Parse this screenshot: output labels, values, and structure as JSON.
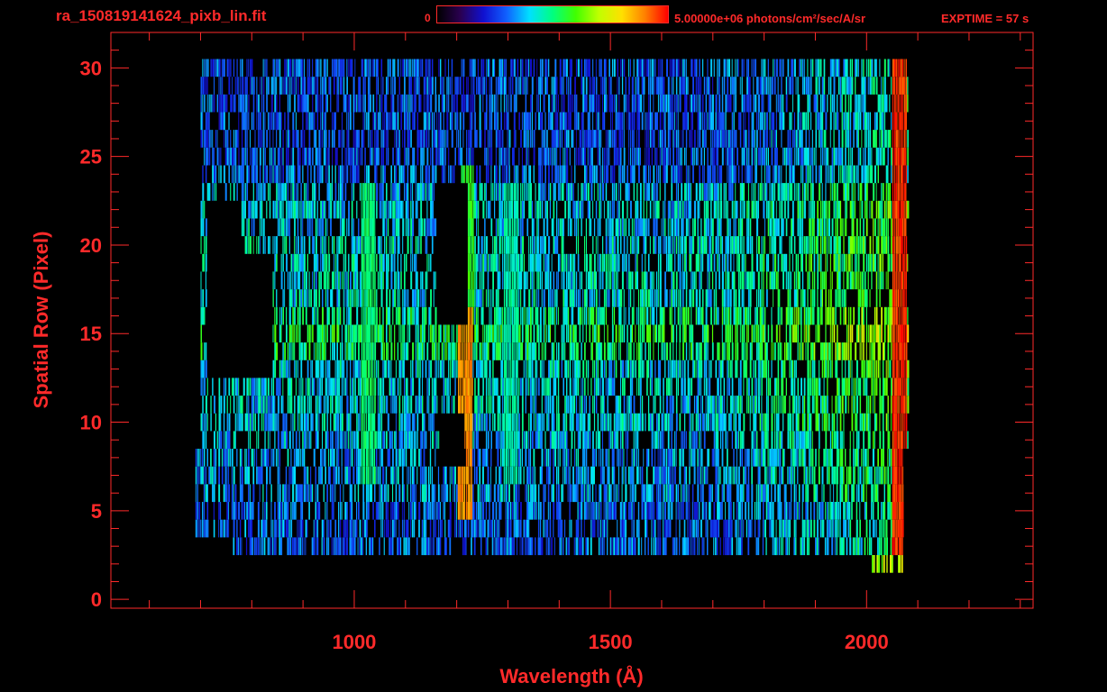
{
  "header": {
    "filename": "ra_150819141624_pixb_lin.fit",
    "colorbar_min_label": "0",
    "colorbar_max_label": "5.00000e+06 photons/cm²/sec/A/sr",
    "exptime_label": "EXPTIME = 57 s"
  },
  "colors": {
    "axis": "#ff2a2a",
    "background": "#000000",
    "colormap": [
      "#000000",
      "#2a0050",
      "#1010d0",
      "#1060ff",
      "#00e0ff",
      "#00ff80",
      "#40ff00",
      "#c0ff00",
      "#ffe000",
      "#ff8000",
      "#ff0000"
    ]
  },
  "chart_data": {
    "type": "heatmap",
    "title": "ra_150819141624_pixb_lin.fit",
    "xlabel": "Wavelength (Å)",
    "ylabel": "Spatial Row (Pixel)",
    "xlim": [
      525,
      2325
    ],
    "ylim": [
      -0.5,
      32
    ],
    "xticks": [
      1000,
      1500,
      2000
    ],
    "yticks": [
      0,
      5,
      10,
      15,
      20,
      25,
      30
    ],
    "colorbar": {
      "min": 0,
      "max": 5000000,
      "units": "photons/cm²/sec/A/sr"
    },
    "rows": [
      {
        "row": 2,
        "x_start": 2010,
        "x_end": 2070,
        "level": 0.5
      },
      {
        "row": 3,
        "x_start": 760,
        "x_end": 2070,
        "level": 0.3
      },
      {
        "row": 4,
        "x_start": 690,
        "x_end": 2070,
        "level": 0.3
      },
      {
        "row": 5,
        "x_start": 690,
        "x_end": 2070,
        "level": 0.3
      },
      {
        "row": 6,
        "x_start": 690,
        "x_end": 2070,
        "level": 0.35
      },
      {
        "row": 7,
        "x_start": 690,
        "x_end": 2070,
        "level": 0.35
      },
      {
        "row": 8,
        "x_start": 690,
        "x_end": 2070,
        "level": 0.35
      },
      {
        "row": 9,
        "x_start": 700,
        "x_end": 2080,
        "level": 0.38
      },
      {
        "row": 10,
        "x_start": 700,
        "x_end": 2080,
        "level": 0.4
      },
      {
        "row": 11,
        "x_start": 700,
        "x_end": 2080,
        "level": 0.4
      },
      {
        "row": 12,
        "x_start": 700,
        "x_end": 2080,
        "level": 0.4
      },
      {
        "row": 13,
        "x_start": 700,
        "x_end": 2080,
        "level": 0.42
      },
      {
        "row": 14,
        "x_start": 700,
        "x_end": 2080,
        "level": 0.5
      },
      {
        "row": 15,
        "x_start": 700,
        "x_end": 2080,
        "level": 0.52
      },
      {
        "row": 16,
        "x_start": 700,
        "x_end": 2080,
        "level": 0.48
      },
      {
        "row": 17,
        "x_start": 700,
        "x_end": 2080,
        "level": 0.42
      },
      {
        "row": 18,
        "x_start": 700,
        "x_end": 2080,
        "level": 0.42
      },
      {
        "row": 19,
        "x_start": 700,
        "x_end": 2080,
        "level": 0.42
      },
      {
        "row": 20,
        "x_start": 700,
        "x_end": 2080,
        "level": 0.42
      },
      {
        "row": 21,
        "x_start": 700,
        "x_end": 2080,
        "level": 0.4
      },
      {
        "row": 22,
        "x_start": 700,
        "x_end": 2080,
        "level": 0.4
      },
      {
        "row": 23,
        "x_start": 700,
        "x_end": 2080,
        "level": 0.38
      },
      {
        "row": 24,
        "x_start": 700,
        "x_end": 2080,
        "level": 0.3
      },
      {
        "row": 25,
        "x_start": 700,
        "x_end": 2080,
        "level": 0.28
      },
      {
        "row": 26,
        "x_start": 700,
        "x_end": 2080,
        "level": 0.28
      },
      {
        "row": 27,
        "x_start": 700,
        "x_end": 2080,
        "level": 0.28
      },
      {
        "row": 28,
        "x_start": 700,
        "x_end": 2080,
        "level": 0.28
      },
      {
        "row": 29,
        "x_start": 700,
        "x_end": 2080,
        "level": 0.28
      },
      {
        "row": 30,
        "x_start": 700,
        "x_end": 2080,
        "level": 0.28
      }
    ],
    "dark_regions": [
      {
        "x_start": 710,
        "x_end": 840,
        "row_start": 13,
        "row_end": 20
      },
      {
        "x_start": 710,
        "x_end": 780,
        "row_start": 20,
        "row_end": 23
      },
      {
        "x_start": 1160,
        "x_end": 1220,
        "row_start": 16,
        "row_end": 24
      },
      {
        "x_start": 1165,
        "x_end": 1215,
        "row_start": 8,
        "row_end": 11
      }
    ],
    "emission_features": [
      {
        "x": 1026,
        "row_start": 7,
        "row_end": 23,
        "level": 0.55
      },
      {
        "x": 1216,
        "row_start": 5,
        "row_end": 16,
        "level": 0.92
      },
      {
        "x": 1220,
        "row_start": 16,
        "row_end": 24,
        "level": 0.62
      },
      {
        "x": 1304,
        "row_start": 7,
        "row_end": 23,
        "level": 0.5
      },
      {
        "x": 2063,
        "row_start": 3,
        "row_end": 30,
        "level": 1.0
      }
    ]
  }
}
